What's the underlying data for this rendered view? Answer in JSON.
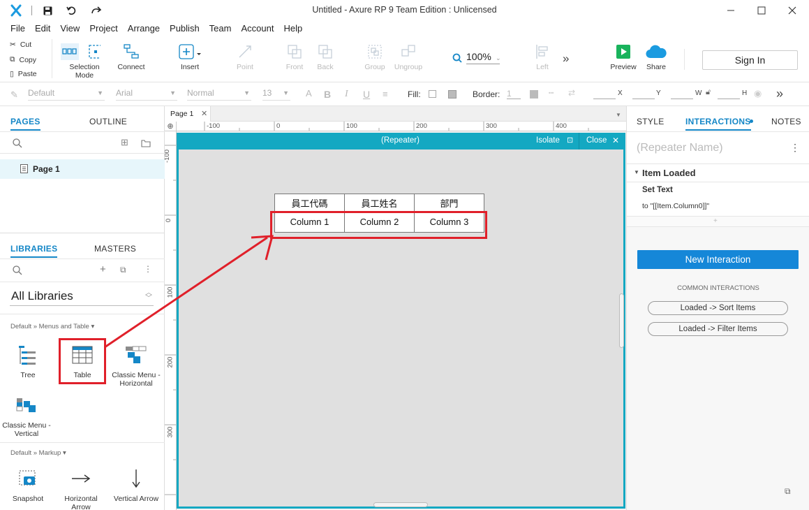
{
  "window": {
    "title": "Untitled - Axure RP 9 Team Edition : Unlicensed",
    "logo": "x-logo-icon"
  },
  "menu": [
    "File",
    "Edit",
    "View",
    "Project",
    "Arrange",
    "Publish",
    "Team",
    "Account",
    "Help"
  ],
  "clipboard": {
    "cut": "Cut",
    "copy": "Copy",
    "paste": "Paste"
  },
  "toolbar": {
    "selection_mode": "Selection Mode",
    "connect": "Connect",
    "insert": "Insert",
    "point": "Point",
    "front": "Front",
    "back": "Back",
    "group": "Group",
    "ungroup": "Ungroup",
    "zoom": "100%",
    "left": "Left",
    "preview": "Preview",
    "share": "Share",
    "sign_in": "Sign In"
  },
  "stylebar": {
    "style": "Default",
    "font": "Arial",
    "weight": "Normal",
    "size": "13",
    "fill": "Fill:",
    "border": "Border:",
    "border_val": "1",
    "x": "X",
    "y": "Y",
    "w": "W",
    "h": "H"
  },
  "leftpanel": {
    "pages_tab": "PAGES",
    "outline_tab": "OUTLINE",
    "page1": "Page 1",
    "libraries_tab": "LIBRARIES",
    "masters_tab": "MASTERS",
    "all_libraries": "All Libraries",
    "section1": "Default » Menus and Table ▾",
    "section2": "Default » Markup ▾",
    "lib_items": {
      "tree": "Tree",
      "table": "Table",
      "classic_h_1": "Classic Menu -",
      "classic_h_2": "Horizontal",
      "classic_v_1": "Classic Menu -",
      "classic_v_2": "Vertical",
      "snapshot": "Snapshot",
      "harrow_1": "Horizontal",
      "harrow_2": "Arrow",
      "varrow": "Vertical Arrow"
    }
  },
  "canvas": {
    "tab": "Page 1",
    "repeater_title": "(Repeater)",
    "isolate": "Isolate",
    "close": "Close",
    "ruler_h": [
      "-100",
      "0",
      "100",
      "200",
      "300",
      "400"
    ],
    "ruler_v": [
      "-100",
      "0",
      "100",
      "200",
      "300"
    ],
    "table_headers": [
      "員工代碼",
      "員工姓名",
      "部門"
    ],
    "table_cells": [
      "Column 1",
      "Column 2",
      "Column 3"
    ]
  },
  "rightpanel": {
    "style_tab": "STYLE",
    "interactions_tab": "INTERACTIONS",
    "notes_tab": "NOTES",
    "name_placeholder": "(Repeater Name)",
    "event": "Item Loaded",
    "action": "Set Text",
    "action_detail": "to \"[[Item.Column0]]\"",
    "new_interaction": "New Interaction",
    "common": "COMMON INTERACTIONS",
    "sort": "Loaded -> Sort Items",
    "filter": "Loaded -> Filter Items"
  },
  "colors": {
    "accent": "#1587c7",
    "repeater": "#14a8c2",
    "annotation": "#e0202a",
    "button": "#1587d8"
  }
}
